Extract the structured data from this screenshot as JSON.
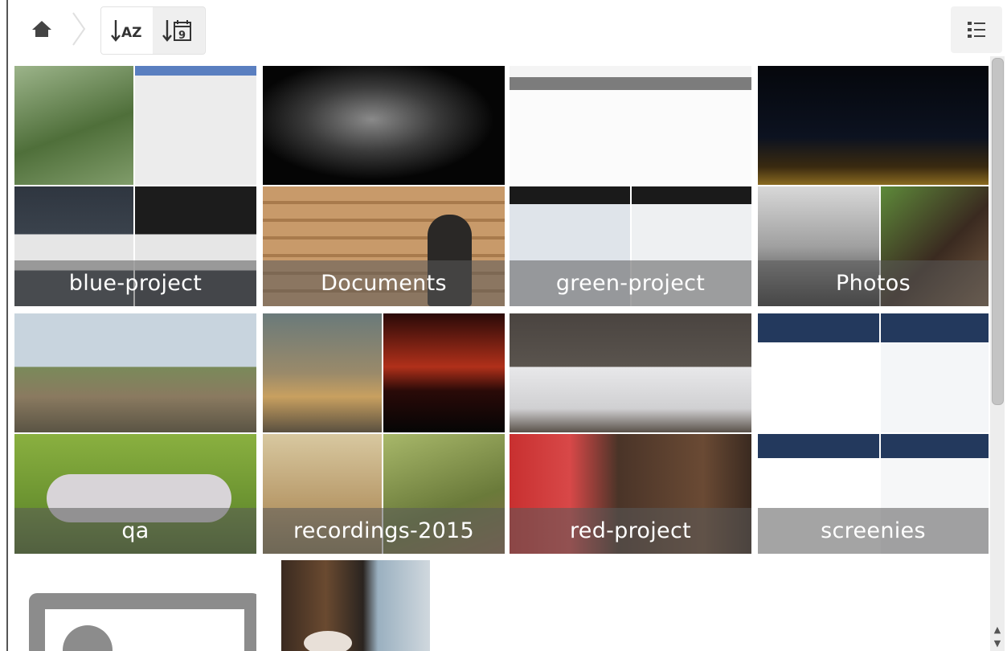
{
  "toolbar": {
    "home_icon": "home-icon",
    "sort_by_name_icon": "sort-alpha-icon",
    "sort_by_name_text": "AZ",
    "sort_by_date_icon": "sort-date-icon",
    "sort_by_date_text": "9",
    "view_toggle_icon": "list-view-icon"
  },
  "albums": [
    {
      "label": "blue-project"
    },
    {
      "label": "Documents"
    },
    {
      "label": "green-project"
    },
    {
      "label": "Photos"
    },
    {
      "label": "qa"
    },
    {
      "label": "recordings-2015"
    },
    {
      "label": "red-project"
    },
    {
      "label": "screenies"
    }
  ],
  "scrollbar": {
    "up_arrow": "▲",
    "down_arrow": "▼"
  }
}
